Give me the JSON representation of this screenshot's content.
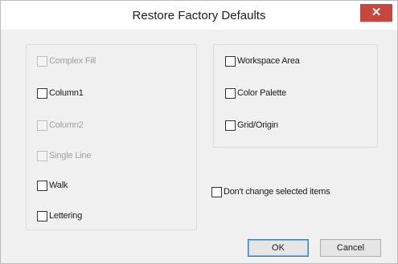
{
  "window": {
    "title": "Restore Factory Defaults",
    "close_glyph": "✕"
  },
  "left_group": {
    "items": [
      {
        "label": "Complex Fill",
        "checked": false,
        "enabled": false
      },
      {
        "label": "Column1",
        "checked": false,
        "enabled": true
      },
      {
        "label": "Column2",
        "checked": false,
        "enabled": false
      },
      {
        "label": "Single Line",
        "checked": false,
        "enabled": false
      },
      {
        "label": "Walk",
        "checked": false,
        "enabled": true
      },
      {
        "label": "Lettering",
        "checked": false,
        "enabled": true
      }
    ]
  },
  "right_group": {
    "items": [
      {
        "label": "Workspace Area",
        "checked": false,
        "enabled": true
      },
      {
        "label": "Color Palette",
        "checked": false,
        "enabled": true
      },
      {
        "label": "Grid/Origin",
        "checked": false,
        "enabled": true
      }
    ]
  },
  "options": {
    "dont_change_label": "Don't change selected items",
    "dont_change_checked": false
  },
  "buttons": {
    "ok_label": "OK",
    "cancel_label": "Cancel"
  },
  "colors": {
    "close_button": "#c7473e",
    "dialog_background": "#f0f0f0",
    "disabled_text": "#a0a0a0"
  },
  "icons": {
    "close": "close-icon"
  }
}
